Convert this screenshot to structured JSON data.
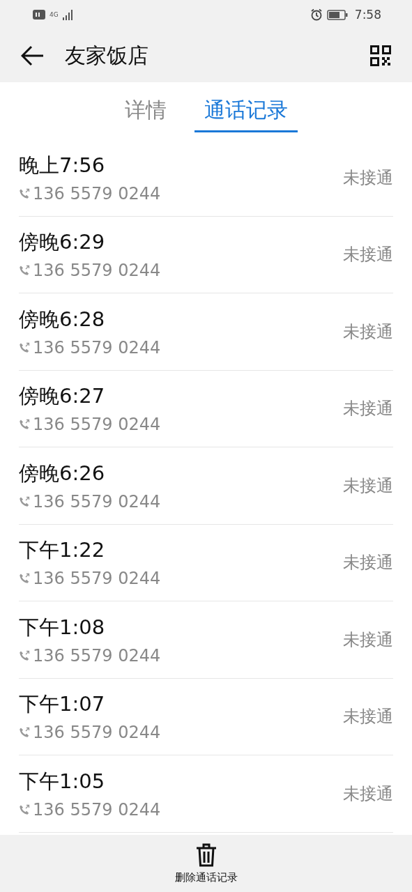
{
  "status_bar": {
    "network": "4G",
    "time": "7:58"
  },
  "header": {
    "title": "友家饭店"
  },
  "tabs": [
    {
      "label": "详情",
      "selected": false
    },
    {
      "label": "通话记录",
      "selected": true
    }
  ],
  "calls": [
    {
      "time": "晚上7:56",
      "number": "136 5579 0244",
      "status": "未接通"
    },
    {
      "time": "傍晚6:29",
      "number": "136 5579 0244",
      "status": "未接通"
    },
    {
      "time": "傍晚6:28",
      "number": "136 5579 0244",
      "status": "未接通"
    },
    {
      "time": "傍晚6:27",
      "number": "136 5579 0244",
      "status": "未接通"
    },
    {
      "time": "傍晚6:26",
      "number": "136 5579 0244",
      "status": "未接通"
    },
    {
      "time": "下午1:22",
      "number": "136 5579 0244",
      "status": "未接通"
    },
    {
      "time": "下午1:08",
      "number": "136 5579 0244",
      "status": "未接通"
    },
    {
      "time": "下午1:07",
      "number": "136 5579 0244",
      "status": "未接通"
    },
    {
      "time": "下午1:05",
      "number": "136 5579 0244",
      "status": "未接通"
    }
  ],
  "bottom_bar": {
    "delete_label": "删除通话记录"
  }
}
